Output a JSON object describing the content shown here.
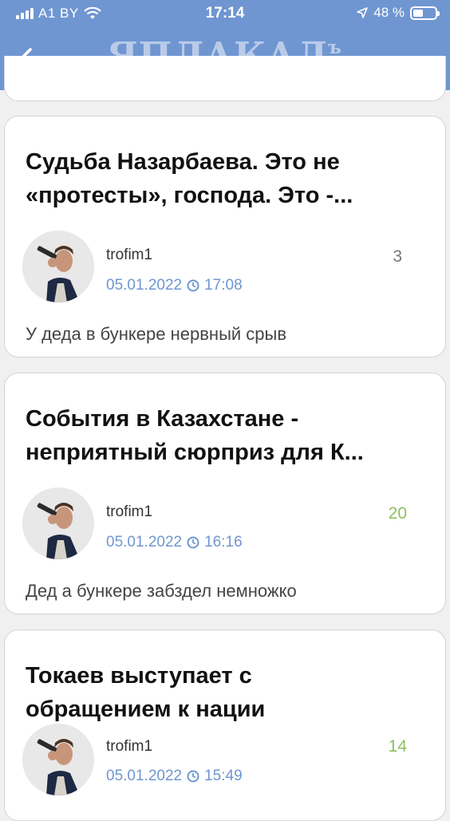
{
  "status_bar": {
    "carrier": "A1 BY",
    "time": "17:14",
    "battery": "48 %",
    "battery_level": 0.48,
    "signal_bars": 4
  },
  "header": {
    "logo_text": "ЯПЛАКАЛ",
    "logo_suffix": "ъ",
    "back_icon": "arrow-left-icon"
  },
  "colors": {
    "header_bg": "#6f96d1",
    "link": "#6f96d1",
    "count_green": "#8fbf5f",
    "count_gray": "#777777"
  },
  "posts": [
    {
      "title_line1": "Судьба Назарбаева. Это не",
      "title_line2": "«протесты», господа. Это -...",
      "author": "trofim1",
      "date": "05.01.2022",
      "time": "17:08",
      "count": "3",
      "preview": "У деда в бункере нервный срыв"
    },
    {
      "title_line1": "События в Казахстане -",
      "title_line2": "неприятный сюрприз для К...",
      "author": "trofim1",
      "date": "05.01.2022",
      "time": "16:16",
      "count": "20",
      "preview": "Дед а бункере забздел немножко"
    },
    {
      "title_line1": "Токаев выступает с",
      "title_line2": "обращением к нации",
      "author": "trofim1",
      "date": "05.01.2022",
      "time": "15:49",
      "count": "14"
    }
  ]
}
